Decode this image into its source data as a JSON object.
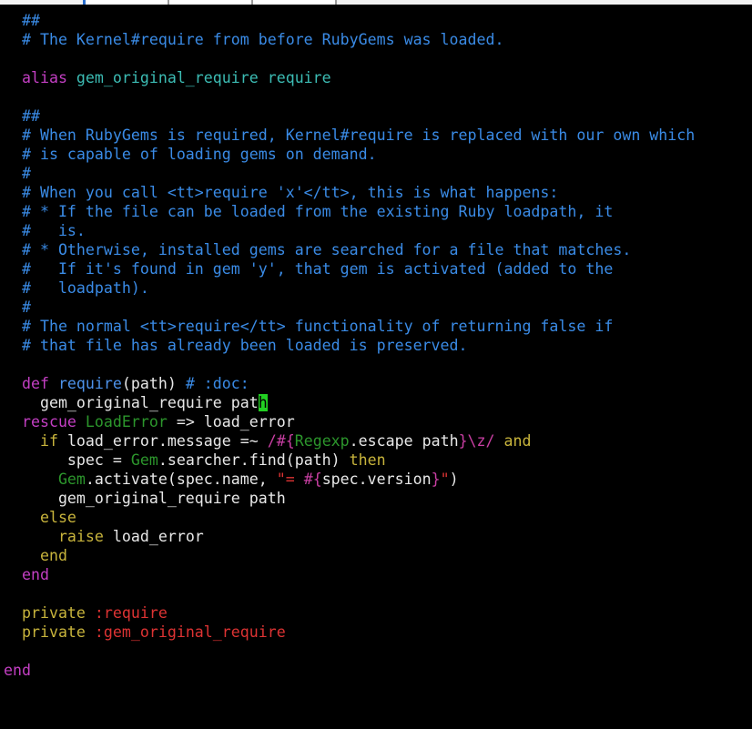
{
  "syntax_colors": {
    "background": "#000000",
    "text": "#e8e8e8",
    "comment": "#3a8be6",
    "keyword": "#c33fc3",
    "method_name": "#4d92ea",
    "alias_name": "#3cbcb4",
    "constant": "#2c962c",
    "control_keyword": "#c8b43c",
    "string_symbol": "#dd3333",
    "special": "#c93fa3",
    "cursor": "#22d022",
    "tab_accent": "#2a6fd0"
  },
  "editor": {
    "lines": [
      [
        "  ##"
      ],
      [
        "  # The Kernel#require from before RubyGems was loaded."
      ],
      [],
      [
        "  alias",
        " gem_original_require require"
      ],
      [],
      [
        "  ##"
      ],
      [
        "  # When RubyGems is required, Kernel#require is replaced with our own which"
      ],
      [
        "  # is capable of loading gems on demand."
      ],
      [
        "  #"
      ],
      [
        "  # When you call <tt>require 'x'</tt>, this is what happens:"
      ],
      [
        "  # * If the file can be loaded from the existing Ruby loadpath, it"
      ],
      [
        "  #   is."
      ],
      [
        "  # * Otherwise, installed gems are searched for a file that matches."
      ],
      [
        "  #   If it's found in gem 'y', that gem is activated (added to the"
      ],
      [
        "  #   loadpath)."
      ],
      [
        "  #"
      ],
      [
        "  # The normal <tt>require</tt> functionality of returning false if"
      ],
      [
        "  # that file has already been loaded is preserved."
      ],
      [],
      [
        "  def",
        " require",
        "(path) ",
        "# :doc:"
      ],
      [
        "    gem_original_require pat",
        "h"
      ],
      [
        "  rescue",
        " LoadError",
        " => load_error"
      ],
      [
        "    if",
        " load_error.message =~ ",
        "/#{",
        "Regexp",
        ".escape path",
        "}\\z/",
        " and"
      ],
      [
        "       spec = ",
        "Gem",
        ".searcher.find(path) ",
        "then"
      ],
      [
        "      Gem",
        ".activate(spec.name, ",
        "\"= ",
        "#{",
        "spec.version",
        "}",
        "\"",
        ")"
      ],
      [
        "      gem_original_require path"
      ],
      [
        "    else"
      ],
      [
        "      raise",
        " load_error"
      ],
      [
        "    end"
      ],
      [
        "  end"
      ],
      [],
      [
        "  private",
        " :require"
      ],
      [
        "  private",
        " :gem_original_require"
      ],
      [],
      [
        "end"
      ]
    ]
  }
}
